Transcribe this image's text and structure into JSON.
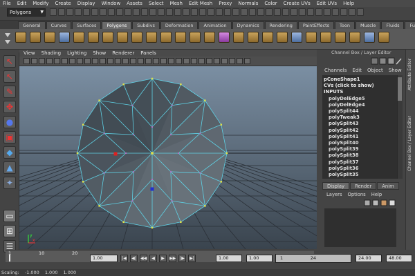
{
  "menubar": [
    "File",
    "Edit",
    "Modify",
    "Create",
    "Display",
    "Window",
    "Assets",
    "Select",
    "Mesh",
    "Edit Mesh",
    "Proxy",
    "Normals",
    "Color",
    "Create UVs",
    "Edit UVs",
    "Help"
  ],
  "status": {
    "mode": "Polygons"
  },
  "shelf_tabs": [
    {
      "label": "General",
      "active": false
    },
    {
      "label": "Curves",
      "active": false
    },
    {
      "label": "Surfaces",
      "active": false
    },
    {
      "label": "Polygons",
      "active": true
    },
    {
      "label": "Subdivs",
      "active": false
    },
    {
      "label": "Deformation",
      "active": false
    },
    {
      "label": "Animation",
      "active": false
    },
    {
      "label": "Dynamics",
      "active": false
    },
    {
      "label": "Rendering",
      "active": false
    },
    {
      "label": "PaintEffects",
      "active": false
    },
    {
      "label": "Toon",
      "active": false
    },
    {
      "label": "Muscle",
      "active": false
    },
    {
      "label": "Fluids",
      "active": false
    },
    {
      "label": "Fur",
      "active": false
    }
  ],
  "panel_menu": [
    "View",
    "Shading",
    "Lighting",
    "Show",
    "Renderer",
    "Panels"
  ],
  "channel_box": {
    "title": "Channel Box / Layer Editor",
    "menu": [
      "Channels",
      "Edit",
      "Object",
      "Show"
    ],
    "items": [
      {
        "text": "pConeShape1",
        "sub": false
      },
      {
        "text": "CVs (click to show)",
        "sub": false
      },
      {
        "text": "INPUTS",
        "sub": false
      },
      {
        "text": "polyDelEdge5",
        "sub": true
      },
      {
        "text": "polyDelEdge4",
        "sub": true
      },
      {
        "text": "polySplit44",
        "sub": true
      },
      {
        "text": "polyTweak3",
        "sub": true
      },
      {
        "text": "polySplit43",
        "sub": true
      },
      {
        "text": "polySplit42",
        "sub": true
      },
      {
        "text": "polySplit41",
        "sub": true
      },
      {
        "text": "polySplit40",
        "sub": true
      },
      {
        "text": "polySplit39",
        "sub": true
      },
      {
        "text": "polySplit38",
        "sub": true
      },
      {
        "text": "polySplit37",
        "sub": true
      },
      {
        "text": "polySplit36",
        "sub": true
      },
      {
        "text": "polySplit35",
        "sub": true
      }
    ]
  },
  "side_tabs": [
    "Attribute Editor",
    "Channel Box / Layer Editor"
  ],
  "layer_editor": {
    "tabs": [
      {
        "label": "Display",
        "active": true
      },
      {
        "label": "Render",
        "active": false
      },
      {
        "label": "Anim",
        "active": false
      }
    ],
    "menu": [
      "Layers",
      "Options",
      "Help"
    ]
  },
  "timeline": {
    "ticks": [
      "1",
      "10",
      "20"
    ],
    "current": "1.00",
    "start": "1.00",
    "range_start": "1.00",
    "range_marker": "1",
    "range_end_marker": "24",
    "end": "24.00",
    "anim_end": "48.00"
  },
  "scaling": {
    "label": "Scaling:",
    "x": "-1.000",
    "y": "1.000",
    "z": "1.000"
  },
  "colors": {
    "wire": "#5ed2e6",
    "vertex": "#e0e04a",
    "selected_red": "#e02020",
    "selected_blue": "#2030d0"
  }
}
